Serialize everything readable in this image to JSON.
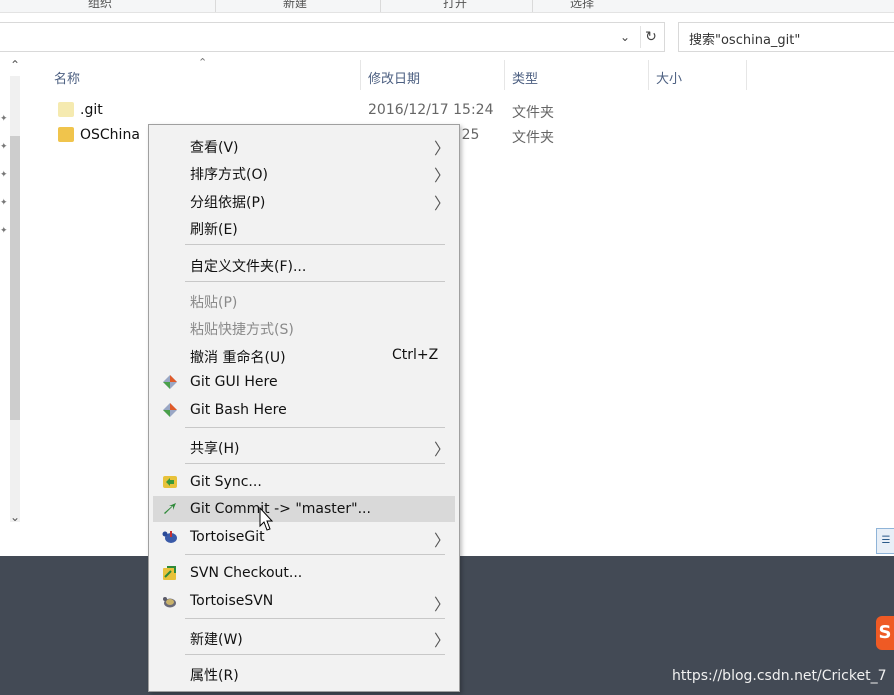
{
  "ribbon": {
    "groups": [
      "组织",
      "新建",
      "打开",
      "选择"
    ]
  },
  "address": {
    "search_placeholder": "搜索\"oschina_git\""
  },
  "columns": {
    "name": "名称",
    "modified": "修改日期",
    "type": "类型",
    "size": "大小"
  },
  "files": [
    {
      "name": ".git",
      "date": "2016/12/17 15:24",
      "type": "文件夹"
    },
    {
      "name": "OSChina",
      "date": "5:25",
      "type": "文件夹"
    }
  ],
  "menu": {
    "view": "查看(V)",
    "sort": "排序方式(O)",
    "group": "分组依据(P)",
    "refresh": "刷新(E)",
    "customize": "自定义文件夹(F)...",
    "paste": "粘贴(P)",
    "paste_shortcut": "粘贴快捷方式(S)",
    "undo": "撤消 重命名(U)",
    "undo_shortcut": "Ctrl+Z",
    "git_gui": "Git GUI Here",
    "git_bash": "Git Bash Here",
    "share": "共享(H)",
    "git_sync": "Git Sync...",
    "git_commit": "Git Commit -> \"master\"...",
    "tortoisegit": "TortoiseGit",
    "svn_checkout": "SVN Checkout...",
    "tortoisesvn": "TortoiseSVN",
    "new": "新建(W)",
    "properties": "属性(R)"
  },
  "watermark": "https://blog.csdn.net/Cricket_7",
  "colors": {
    "menu_bg": "#f2f2f2",
    "menu_hover": "#d9d9d9",
    "taskbar": "#434a55",
    "column_header_text": "#4d6082"
  }
}
